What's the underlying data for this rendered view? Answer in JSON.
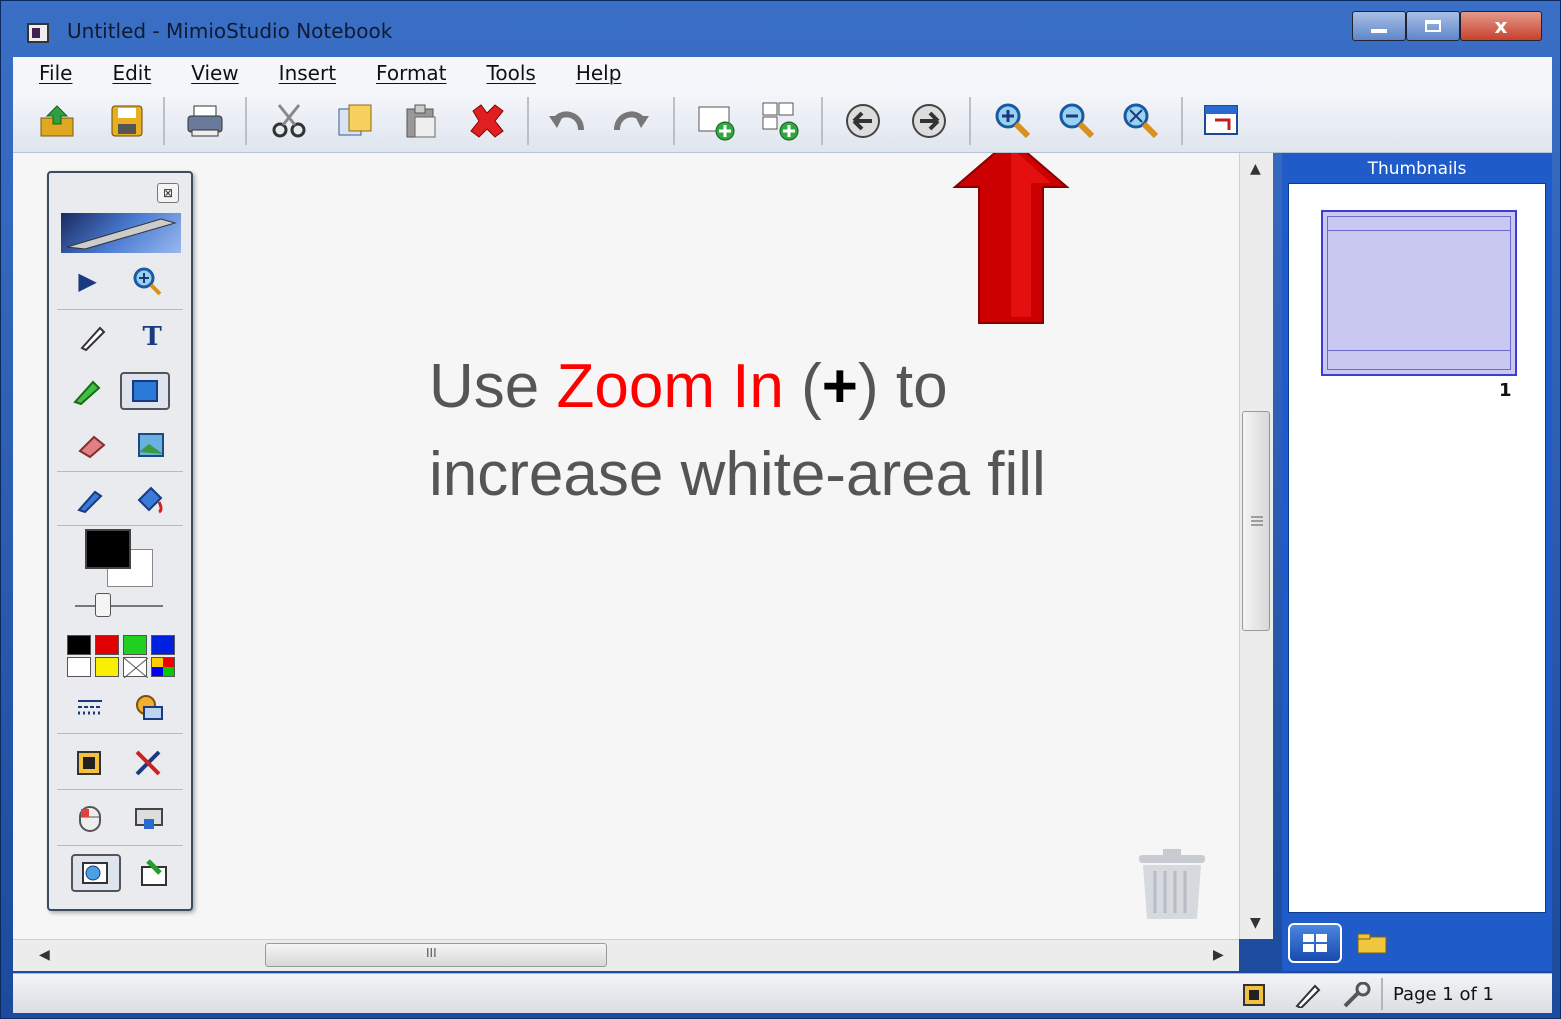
{
  "window": {
    "title": "Untitled - MimioStudio Notebook",
    "close_label": "x"
  },
  "menu": [
    "File",
    "Edit",
    "View",
    "Insert",
    "Format",
    "Tools",
    "Help"
  ],
  "slide": {
    "line1_prefix": "Use  ",
    "line1_highlight": "Zoom In",
    "line1_paren_open": " (",
    "line1_plus": "+",
    "line1_paren_close": ") to",
    "line2": "increase white-area fill",
    "highlight_color": "#ff0000",
    "arrow_color": "#cc0000"
  },
  "thumbnails_panel": {
    "title": "Thumbnails",
    "page_number": "1"
  },
  "hscroll_grip": "III",
  "statusbar": {
    "page_label": "Page 1 of 1"
  }
}
